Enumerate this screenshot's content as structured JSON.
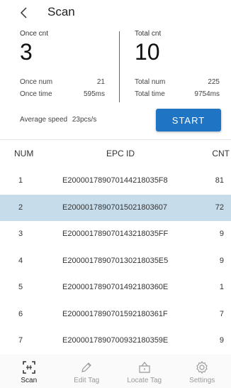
{
  "header": {
    "title": "Scan"
  },
  "stats": {
    "once_cnt_label": "Once cnt",
    "once_cnt_value": "3",
    "total_cnt_label": "Total cnt",
    "total_cnt_value": "10",
    "once_num_label": "Once num",
    "once_num_value": "21",
    "once_time_label": "Once time",
    "once_time_value": "595ms",
    "total_num_label": "Total num",
    "total_num_value": "225",
    "total_time_label": "Total time",
    "total_time_value": "9754ms",
    "avg_speed_label": "Average speed",
    "avg_speed_value": "23pcs/s",
    "start_label": "START"
  },
  "table": {
    "headers": {
      "num": "NUM",
      "epc": "EPC ID",
      "cnt": "CNT"
    },
    "selected_index": 1,
    "rows": [
      {
        "num": "1",
        "epc": "E20000178907014421803 5F8",
        "cnt": "81"
      },
      {
        "num": "2",
        "epc": "E20000178907015021803607",
        "cnt": "72"
      },
      {
        "num": "3",
        "epc": "E200001789070143218035FF",
        "cnt": "9"
      },
      {
        "num": "4",
        "epc": "E200001789070130218035E5",
        "cnt": "9"
      },
      {
        "num": "5",
        "epc": "E2000017890701492180360E",
        "cnt": "1"
      },
      {
        "num": "6",
        "epc": "E2000017890701592180361F",
        "cnt": "7"
      },
      {
        "num": "7",
        "epc": "E200001789070093218035 9E",
        "cnt": "9"
      }
    ]
  },
  "nav": {
    "active": "scan",
    "items": [
      {
        "key": "scan",
        "label": "Scan",
        "icon": "scan-icon"
      },
      {
        "key": "edit",
        "label": "Edit Tag",
        "icon": "pencil-icon"
      },
      {
        "key": "locate",
        "label": "Locate Tag",
        "icon": "tag-icon"
      },
      {
        "key": "settings",
        "label": "Settings",
        "icon": "gear-icon"
      }
    ]
  }
}
